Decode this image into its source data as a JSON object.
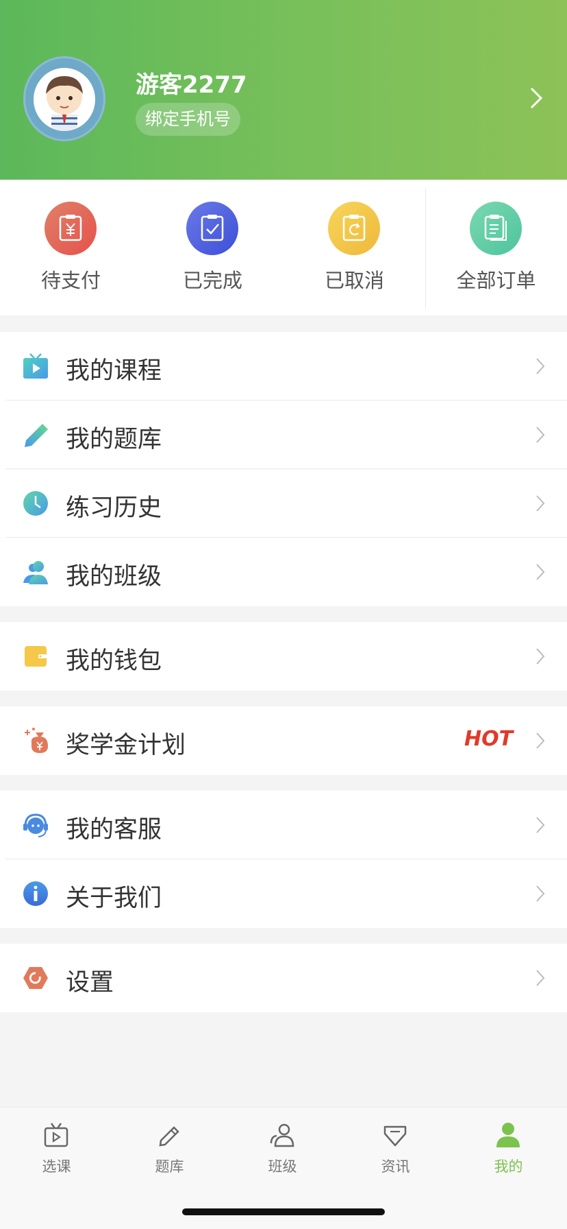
{
  "profile": {
    "username": "游客2277",
    "bind_phone_label": "绑定手机号"
  },
  "orders": [
    {
      "label": "待支付",
      "icon": "pending-payment-icon",
      "color": "#e5654a"
    },
    {
      "label": "已完成",
      "icon": "completed-icon",
      "color": "#4a63e0"
    },
    {
      "label": "已取消",
      "icon": "cancelled-icon",
      "color": "#f1c64a"
    },
    {
      "label": "全部订单",
      "icon": "all-orders-icon",
      "color": "#5fcba0"
    }
  ],
  "menu": {
    "courses": "我的课程",
    "question_bank": "我的题库",
    "practice_history": "练习历史",
    "my_class": "我的班级",
    "wallet": "我的钱包",
    "scholarship": "奖学金计划",
    "scholarship_badge": "HOT",
    "customer_service": "我的客服",
    "about_us": "关于我们",
    "settings": "设置"
  },
  "tabs": [
    {
      "label": "选课",
      "icon": "video-course-icon"
    },
    {
      "label": "题库",
      "icon": "pencil-icon"
    },
    {
      "label": "班级",
      "icon": "people-icon"
    },
    {
      "label": "资讯",
      "icon": "diamond-icon"
    },
    {
      "label": "我的",
      "icon": "person-icon",
      "active": true
    }
  ],
  "colors": {
    "header_green": "#6cbb58",
    "accent_active": "#7cc34e",
    "hot_red": "#e03a2a"
  }
}
